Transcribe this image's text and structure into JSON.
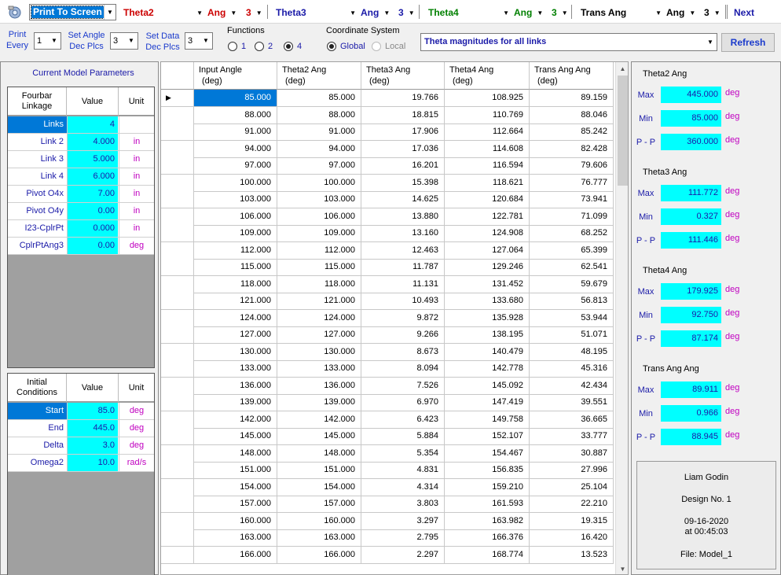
{
  "toolbar": {
    "print_mode": "Print To Screen",
    "sections": [
      {
        "name": "Theta2",
        "kind": "Ang",
        "decimals": "3",
        "color": "#cc0000"
      },
      {
        "name": "Theta3",
        "kind": "Ang",
        "decimals": "3",
        "color": "#1a1aa8"
      },
      {
        "name": "Theta4",
        "kind": "Ang",
        "decimals": "3",
        "color": "#008000"
      },
      {
        "name": "Trans Ang",
        "kind": "Ang",
        "decimals": "3",
        "color": "#000000"
      }
    ],
    "next_label": "Next"
  },
  "options": {
    "print_every_label_1": "Print",
    "print_every_label_2": "Every",
    "print_every_value": "1",
    "angle_dec_label_1": "Set Angle",
    "angle_dec_label_2": "Dec Plcs",
    "angle_dec_value": "3",
    "data_dec_label_1": "Set Data",
    "data_dec_label_2": "Dec Plcs",
    "data_dec_value": "3",
    "functions_label": "Functions",
    "functions": [
      "1",
      "2",
      "4"
    ],
    "functions_selected": "4",
    "coord_label": "Coordinate System",
    "coord_global": "Global",
    "coord_local": "Local",
    "display_selection": "Theta magnitudes for all links",
    "refresh_label": "Refresh"
  },
  "left_panel": {
    "title": "Current Model Parameters",
    "model": {
      "header": [
        "Fourbar Linkage",
        "Value",
        "Unit"
      ],
      "rows": [
        {
          "name": "Links",
          "value": "4",
          "unit": ""
        },
        {
          "name": "Link 2",
          "value": "4.000",
          "unit": "in"
        },
        {
          "name": "Link 3",
          "value": "5.000",
          "unit": "in"
        },
        {
          "name": "Link 4",
          "value": "6.000",
          "unit": "in"
        },
        {
          "name": "Pivot O4x",
          "value": "7.00",
          "unit": "in"
        },
        {
          "name": "Pivot O4y",
          "value": "0.00",
          "unit": "in"
        },
        {
          "name": "I23-CplrPt",
          "value": "0.000",
          "unit": "in"
        },
        {
          "name": "CplrPtAng3",
          "value": "0.00",
          "unit": "deg"
        }
      ]
    },
    "initial": {
      "header": [
        "Initial Conditions",
        "Value",
        "Unit"
      ],
      "rows": [
        {
          "name": "Start",
          "value": "85.0",
          "unit": "deg"
        },
        {
          "name": "End",
          "value": "445.0",
          "unit": "deg"
        },
        {
          "name": "Delta",
          "value": "3.0",
          "unit": "deg"
        },
        {
          "name": "Omega2",
          "value": "10.0",
          "unit": "rad/s"
        }
      ]
    }
  },
  "grid": {
    "columns": [
      "Input Angle\n(deg)",
      "Theta2 Ang\n(deg)",
      "Theta3 Ang\n(deg)",
      "Theta4 Ang\n(deg)",
      "Trans Ang Ang\n(deg)"
    ],
    "rows": [
      [
        "85.000",
        "85.000",
        "19.766",
        "108.925",
        "89.159"
      ],
      [
        "88.000",
        "88.000",
        "18.815",
        "110.769",
        "88.046"
      ],
      [
        "91.000",
        "91.000",
        "17.906",
        "112.664",
        "85.242"
      ],
      [
        "94.000",
        "94.000",
        "17.036",
        "114.608",
        "82.428"
      ],
      [
        "97.000",
        "97.000",
        "16.201",
        "116.594",
        "79.606"
      ],
      [
        "100.000",
        "100.000",
        "15.398",
        "118.621",
        "76.777"
      ],
      [
        "103.000",
        "103.000",
        "14.625",
        "120.684",
        "73.941"
      ],
      [
        "106.000",
        "106.000",
        "13.880",
        "122.781",
        "71.099"
      ],
      [
        "109.000",
        "109.000",
        "13.160",
        "124.908",
        "68.252"
      ],
      [
        "112.000",
        "112.000",
        "12.463",
        "127.064",
        "65.399"
      ],
      [
        "115.000",
        "115.000",
        "11.787",
        "129.246",
        "62.541"
      ],
      [
        "118.000",
        "118.000",
        "11.131",
        "131.452",
        "59.679"
      ],
      [
        "121.000",
        "121.000",
        "10.493",
        "133.680",
        "56.813"
      ],
      [
        "124.000",
        "124.000",
        "9.872",
        "135.928",
        "53.944"
      ],
      [
        "127.000",
        "127.000",
        "9.266",
        "138.195",
        "51.071"
      ],
      [
        "130.000",
        "130.000",
        "8.673",
        "140.479",
        "48.195"
      ],
      [
        "133.000",
        "133.000",
        "8.094",
        "142.778",
        "45.316"
      ],
      [
        "136.000",
        "136.000",
        "7.526",
        "145.092",
        "42.434"
      ],
      [
        "139.000",
        "139.000",
        "6.970",
        "147.419",
        "39.551"
      ],
      [
        "142.000",
        "142.000",
        "6.423",
        "149.758",
        "36.665"
      ],
      [
        "145.000",
        "145.000",
        "5.884",
        "152.107",
        "33.777"
      ],
      [
        "148.000",
        "148.000",
        "5.354",
        "154.467",
        "30.887"
      ],
      [
        "151.000",
        "151.000",
        "4.831",
        "156.835",
        "27.996"
      ],
      [
        "154.000",
        "154.000",
        "4.314",
        "159.210",
        "25.104"
      ],
      [
        "157.000",
        "157.000",
        "3.803",
        "161.593",
        "22.210"
      ],
      [
        "160.000",
        "160.000",
        "3.297",
        "163.982",
        "19.315"
      ],
      [
        "163.000",
        "163.000",
        "2.795",
        "166.376",
        "16.420"
      ],
      [
        "166.000",
        "166.000",
        "2.297",
        "168.774",
        "13.523"
      ]
    ]
  },
  "stats": [
    {
      "title": "Theta2 Ang",
      "max": "445.000",
      "min": "85.000",
      "pp": "360.000",
      "unit": "deg"
    },
    {
      "title": "Theta3 Ang",
      "max": "111.772",
      "min": "0.327",
      "pp": "111.446",
      "unit": "deg"
    },
    {
      "title": "Theta4 Ang",
      "max": "179.925",
      "min": "92.750",
      "pp": "87.174",
      "unit": "deg"
    },
    {
      "title": "Trans Ang Ang",
      "max": "89.911",
      "min": "0.966",
      "pp": "88.945",
      "unit": "deg"
    }
  ],
  "stat_labels": {
    "max": "Max",
    "min": "Min",
    "pp": "P - P"
  },
  "info": {
    "author": "Liam Godin",
    "design": "Design No. 1",
    "date": "09-16-2020",
    "time": "at 00:45:03",
    "file": "File: Model_1"
  }
}
